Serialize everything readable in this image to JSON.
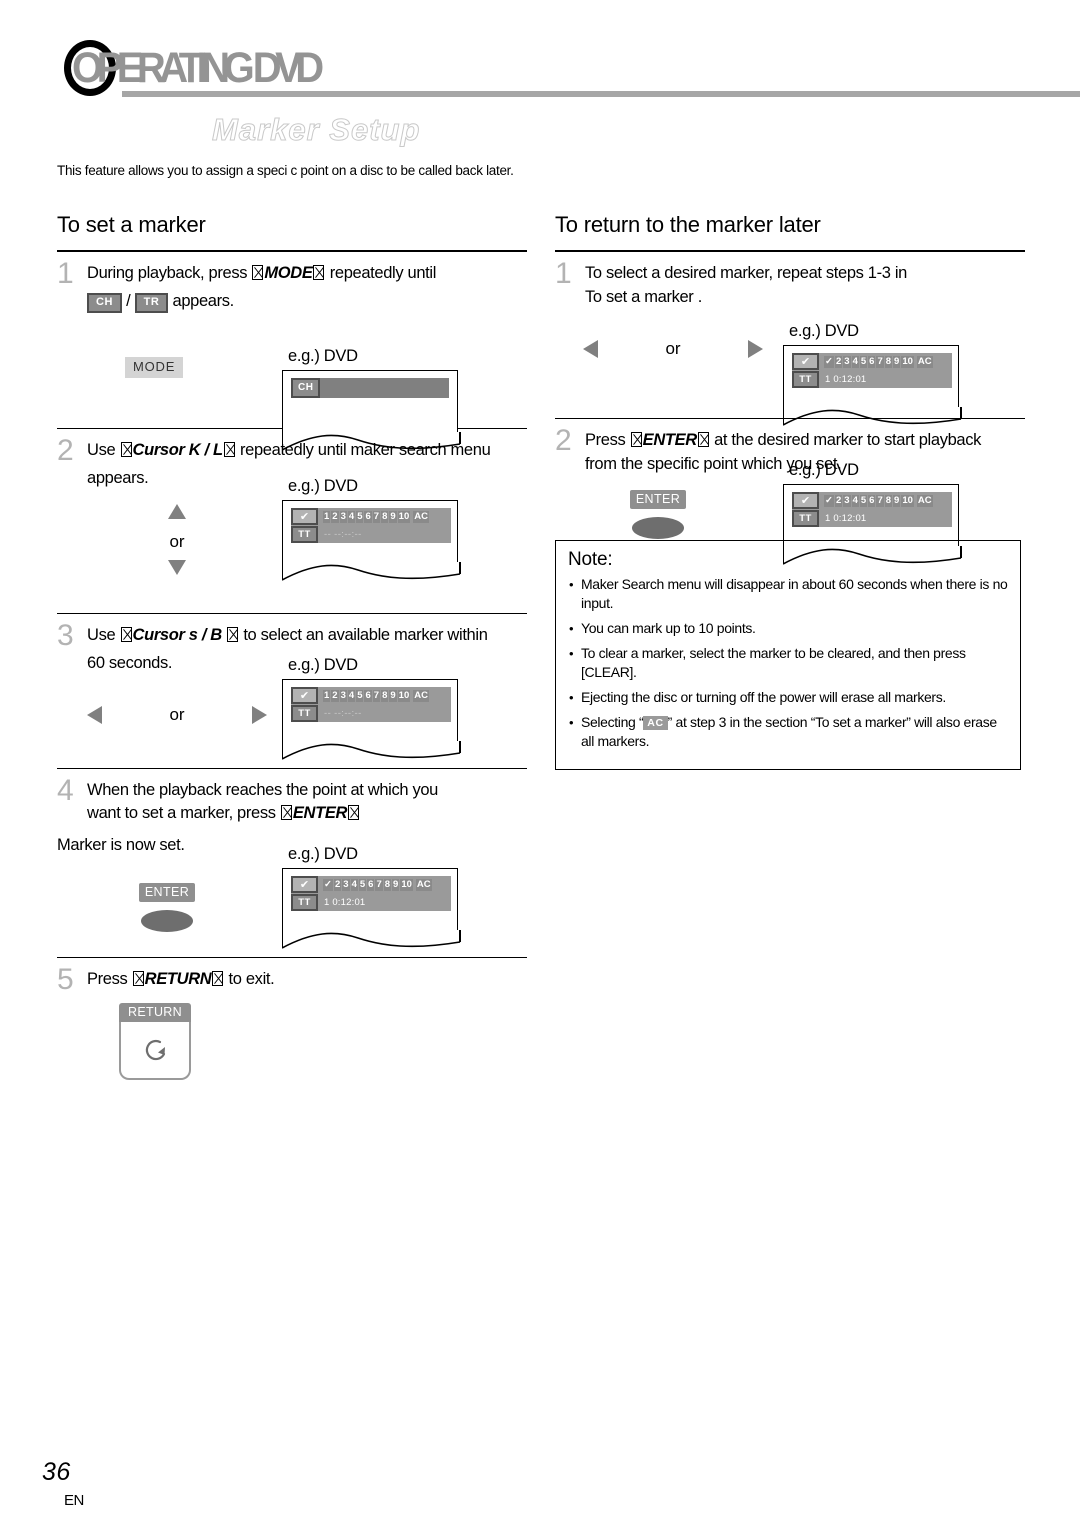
{
  "header": {
    "title": "OPERATING DVD",
    "subtitle": "Marker Setup",
    "intro": "This feature allows you to assign a speci c point on a disc to be called back later."
  },
  "left_column": {
    "heading": "To set a marker",
    "steps": [
      {
        "num": "1",
        "text_a": "During playback, press ",
        "key": "MODE",
        "text_b": " repeatedly until",
        "line2_badge1": "CH",
        "line2_sep": "/",
        "line2_badge2": "TR",
        "line2_tail": "appears.",
        "key_button": "MODE",
        "eg_label": "e.g.) DVD"
      },
      {
        "num": "2",
        "text_a": "Use ",
        "key": "Cursor K / L",
        "text_b": " repeatedly until maker search menu",
        "line2": "appears.",
        "or_label": "or",
        "eg_label": "e.g.) DVD"
      },
      {
        "num": "3",
        "text_a": "Use ",
        "key": "Cursor s  / B ",
        "text_b": " to select an available marker within",
        "line2": "60 seconds.",
        "or_label": "or",
        "eg_label": "e.g.) DVD"
      },
      {
        "num": "4",
        "text_a": "When the playback reaches the point at which you",
        "line2_a": "want to set a marker, press ",
        "key": "ENTER",
        "note": "Marker is now set.",
        "key_button": "ENTER",
        "eg_label": "e.g.) DVD"
      },
      {
        "num": "5",
        "text_a": "Press ",
        "key": "RETURN",
        "text_b": " to exit.",
        "key_button": "RETURN"
      }
    ]
  },
  "right_column": {
    "heading": "To return to the marker later",
    "steps": [
      {
        "num": "1",
        "text_a": "To select a desired marker, repeat steps 1-3 in",
        "line2": "To set a marker .",
        "or_label": "or",
        "eg_label": "e.g.) DVD"
      },
      {
        "num": "2",
        "text_a": "Press ",
        "key": "ENTER",
        "text_b": " at the desired marker to start playback",
        "line2": "from the specific point which you set.",
        "key_button": "ENTER",
        "eg_label": "e.g.) DVD"
      }
    ],
    "note": {
      "title": "Note:",
      "items": [
        "Maker Search menu will disappear in about 60 seconds when there is no input.",
        "You can mark up to 10 points.",
        "To clear a marker, select the marker to be cleared, and then press [CLEAR].",
        "Ejecting the disc or turning off the power will erase all markers."
      ],
      "last_item_a": "Selecting “",
      "last_item_badge": "AC",
      "last_item_b": "” at step 3 in the section “To set a marker” will also erase all markers."
    }
  },
  "osd": {
    "ch_tag": "CH",
    "tr_tag": "TR",
    "tt_tag": "TT",
    "check_glyph": "✔",
    "numbers_empty": [
      "1",
      "2",
      "3",
      "4",
      "5",
      "6",
      "7",
      "8",
      "9",
      "10"
    ],
    "numbers_marked": [
      "✓",
      "2",
      "3",
      "4",
      "5",
      "6",
      "7",
      "8",
      "9",
      "10"
    ],
    "ac_label": "AC",
    "time_empty": "-- --:--:--",
    "time_set": "1  0:12:01"
  },
  "footer": {
    "page": "36",
    "lang": "EN"
  },
  "colors": {
    "title_gray": "#949494",
    "step_num_gray": "#b3b3b3",
    "osd_panel": "#9a9a9a",
    "badge_fill": "#8c8c8c",
    "badge_border": "#4d4d4d"
  }
}
